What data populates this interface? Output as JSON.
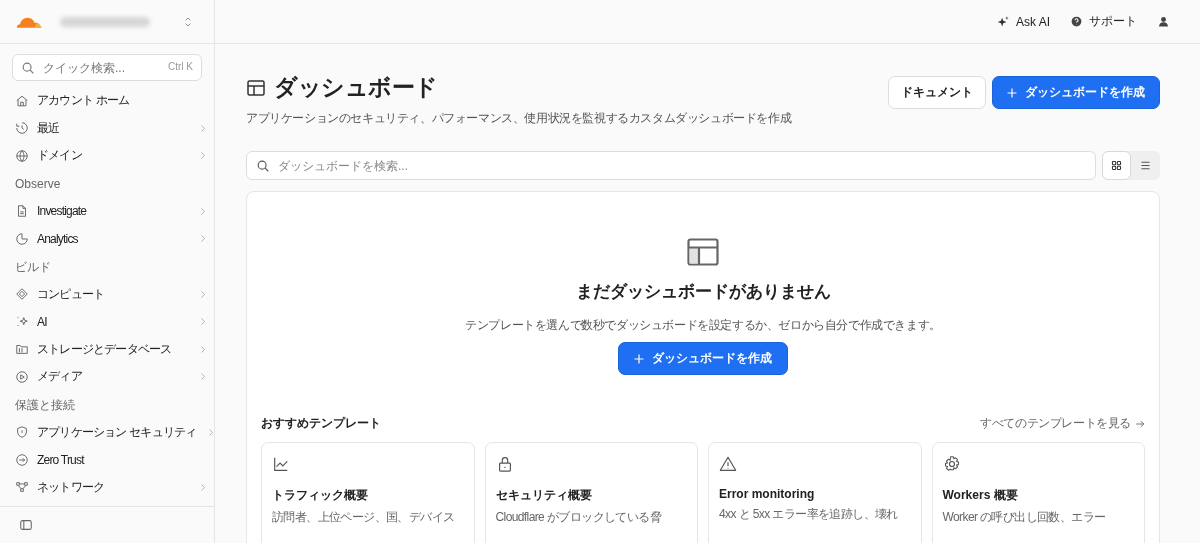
{
  "sidebar": {
    "search": {
      "placeholder": "クイック検索...",
      "shortcut": "Ctrl K"
    },
    "nav": [
      {
        "kind": "item",
        "label": "アカウント ホーム",
        "expandable": false
      },
      {
        "kind": "item",
        "label": "最近",
        "expandable": true
      },
      {
        "kind": "item",
        "label": "ドメイン",
        "expandable": true
      },
      {
        "kind": "section",
        "label": "Observe"
      },
      {
        "kind": "item",
        "label": "Investigate",
        "expandable": true
      },
      {
        "kind": "item",
        "label": "Analytics",
        "expandable": true
      },
      {
        "kind": "section",
        "label": "ビルド"
      },
      {
        "kind": "item",
        "label": "コンピュート",
        "expandable": true
      },
      {
        "kind": "item",
        "label": "AI",
        "expandable": true
      },
      {
        "kind": "item",
        "label": "ストレージとデータベース",
        "expandable": true
      },
      {
        "kind": "item",
        "label": "メディア",
        "expandable": true
      },
      {
        "kind": "section",
        "label": "保護と接続"
      },
      {
        "kind": "item",
        "label": "アプリケーション セキュリティ",
        "expandable": true
      },
      {
        "kind": "item",
        "label": "Zero Trust",
        "expandable": false
      },
      {
        "kind": "item",
        "label": "ネットワーク",
        "expandable": true
      }
    ]
  },
  "topbar": {
    "ask_ai": "Ask AI",
    "support": "サポート"
  },
  "header": {
    "title": "ダッシュボード",
    "subtitle": "アプリケーションのセキュリティ、パフォーマンス、使用状況を監視するカスタムダッシュボードを作成",
    "docs_button": "ドキュメント",
    "create_button": "ダッシュボードを作成"
  },
  "search": {
    "placeholder": "ダッシュボードを検索..."
  },
  "view_toggle": [
    {
      "kind": "grid",
      "selected": true
    },
    {
      "kind": "list",
      "selected": false
    }
  ],
  "empty_state": {
    "title": "まだダッシュボードがありません",
    "text": "テンプレートを選んで数秒でダッシュボードを設定するか、ゼロから自分で作成できます。",
    "button": "ダッシュボードを作成"
  },
  "templates": {
    "title": "おすすめテンプレート",
    "see_all": "すべてのテンプレートを見る",
    "cards": [
      {
        "kind": "chart",
        "title": "トラフィック概要",
        "description": "訪問者、上位ページ、国、デバイス"
      },
      {
        "kind": "lock",
        "title": "セキュリティ概要",
        "description": "Cloudflare がブロックしている脅"
      },
      {
        "kind": "warning",
        "title": "Error monitoring",
        "description": "4xx と 5xx エラー率を追跡し、壊れ"
      },
      {
        "kind": "gear",
        "title": "Workers 概要",
        "description": "Worker の呼び出し回数、エラー"
      }
    ]
  }
}
